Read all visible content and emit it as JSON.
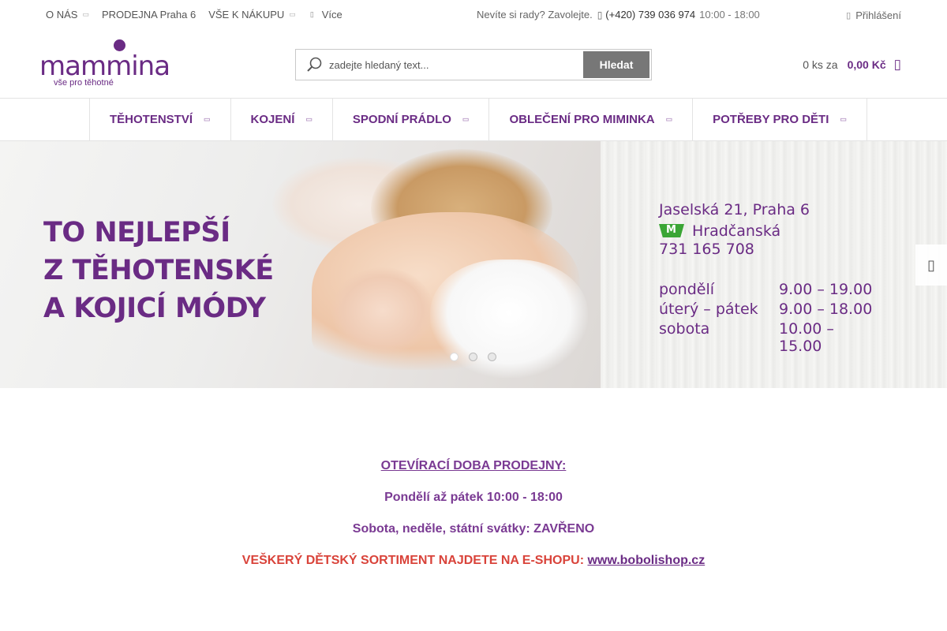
{
  "topbar": {
    "about": "O NÁS",
    "store": "PRODEJNA Praha 6",
    "shopping": "VŠE K NÁKUPU",
    "more": "Více",
    "help_text": "Nevíte si rady? Zavolejte.",
    "phone": "(+420) 739 036 974",
    "hours": "10:00 - 18:00",
    "login": "Přihlášení"
  },
  "logo": {
    "word": "mammina",
    "tagline": "vše pro těhotné"
  },
  "search": {
    "placeholder": "zadejte hledaný text...",
    "button": "Hledat"
  },
  "cart": {
    "count": "0 ks za",
    "price": "0,00 Kč"
  },
  "nav": [
    {
      "label": "TĚHOTENSTVÍ"
    },
    {
      "label": "KOJENÍ"
    },
    {
      "label": "SPODNÍ PRÁDLO"
    },
    {
      "label": "OBLEČENÍ PRO MIMINKA"
    },
    {
      "label": "POTŘEBY PRO DĚTI"
    }
  ],
  "banner": {
    "headline": [
      "TO NEJLEPŠÍ",
      "Z TĚHOTENSKÉ",
      "A KOJICÍ MÓDY"
    ],
    "address": "Jaselská 21, Praha 6",
    "metro": "Hradčanská",
    "phone": "731 165 708",
    "schedule": [
      {
        "day": "pondělí",
        "time": "9.00 – 19.00"
      },
      {
        "day": "úterý – pátek",
        "time": "9.00 – 18.00"
      },
      {
        "day": "sobota",
        "time": "10.00 – 15.00"
      }
    ],
    "active_slide": 1,
    "slide_count": 3
  },
  "content": {
    "title": "OTEVÍRACÍ DOBA PRODEJNY:",
    "weekdays": "Pondělí až pátek 10:00 - 18:00",
    "weekend": "Sobota, neděle, státní svátky: ZAVŘENO",
    "eshop_text": "VEŠKERÝ DĚTSKÝ SORTIMENT NAJDETE NA E-SHOPU:",
    "eshop_link": "www.bobolishop.cz"
  },
  "colors": {
    "brand": "#6a2b84",
    "accent_red": "#d9433a",
    "metro_green": "#3aa535"
  }
}
